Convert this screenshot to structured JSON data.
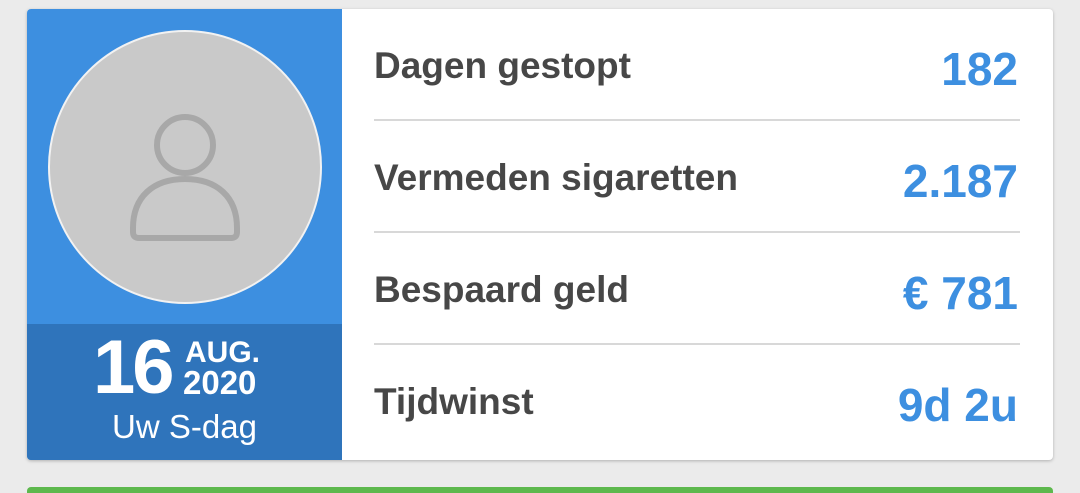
{
  "profile": {
    "day": "16",
    "month": "AUG.",
    "year": "2020",
    "caption": "Uw S-dag"
  },
  "stats": [
    {
      "label": "Dagen gestopt",
      "value": "182"
    },
    {
      "label": "Vermeden sigaretten",
      "value": "2.187"
    },
    {
      "label": "Bespaard geld",
      "value": "€ 781"
    },
    {
      "label": "Tijdwinst",
      "value": "9d 2u"
    }
  ],
  "colors": {
    "accent": "#3d8fe0",
    "date_bg": "#2f74bb",
    "label_text": "#474747",
    "next_card_accent": "#5db84d"
  },
  "icons": {
    "avatar": "user-silhouette-icon"
  }
}
